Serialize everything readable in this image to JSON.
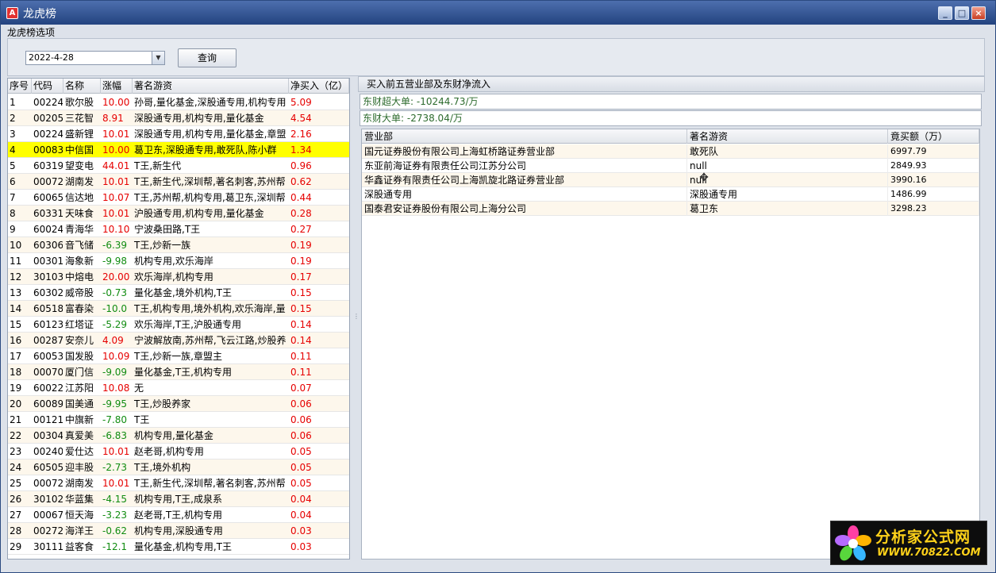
{
  "window": {
    "title": "龙虎榜",
    "app_icon": "A",
    "controls": [
      "_",
      "□",
      "×"
    ]
  },
  "filter": {
    "section_title": "龙虎榜选项",
    "date_value": "2022-4-28",
    "query_label": "查询"
  },
  "stock_list": {
    "headers": [
      "序号",
      "代码",
      "名称",
      "涨幅",
      "著名游资",
      "净买入（亿）"
    ],
    "rows": [
      {
        "no": "1",
        "code": "00224",
        "name": "歌尔股",
        "chg": "10.00",
        "fund": "孙哥,量化基金,深股通专用,机构专用",
        "net": "5.09",
        "dir": "up"
      },
      {
        "no": "2",
        "code": "00205",
        "name": "三花智",
        "chg": "8.91",
        "fund": "深股通专用,机构专用,量化基金",
        "net": "4.54",
        "dir": "up"
      },
      {
        "no": "3",
        "code": "00224",
        "name": "盛新锂",
        "chg": "10.01",
        "fund": "深股通专用,机构专用,量化基金,章盟",
        "net": "2.16",
        "dir": "up"
      },
      {
        "no": "4",
        "code": "00083",
        "name": "中信国",
        "chg": "10.00",
        "fund": "葛卫东,深股通专用,敢死队,陈小群",
        "net": "1.34",
        "dir": "up"
      },
      {
        "no": "5",
        "code": "60319",
        "name": "望变电",
        "chg": "44.01",
        "fund": "T王,新生代",
        "net": "0.96",
        "dir": "up"
      },
      {
        "no": "6",
        "code": "00072",
        "name": "湖南发",
        "chg": "10.01",
        "fund": "T王,新生代,深圳帮,著名刺客,苏州帮",
        "net": "0.62",
        "dir": "up"
      },
      {
        "no": "7",
        "code": "60065",
        "name": "信达地",
        "chg": "10.07",
        "fund": "T王,苏州帮,机构专用,葛卫东,深圳帮",
        "net": "0.44",
        "dir": "up"
      },
      {
        "no": "8",
        "code": "60331",
        "name": "天味食",
        "chg": "10.01",
        "fund": "沪股通专用,机构专用,量化基金",
        "net": "0.28",
        "dir": "up"
      },
      {
        "no": "9",
        "code": "60024",
        "name": "青海华",
        "chg": "10.10",
        "fund": "宁波桑田路,T王",
        "net": "0.27",
        "dir": "up"
      },
      {
        "no": "10",
        "code": "60306",
        "name": "音飞储",
        "chg": "-6.39",
        "fund": "T王,炒新一族",
        "net": "0.19",
        "dir": "down"
      },
      {
        "no": "11",
        "code": "00301",
        "name": "海象新",
        "chg": "-9.98",
        "fund": "机构专用,欢乐海岸",
        "net": "0.19",
        "dir": "down"
      },
      {
        "no": "12",
        "code": "30103",
        "name": "中熔电",
        "chg": "20.00",
        "fund": "欢乐海岸,机构专用",
        "net": "0.17",
        "dir": "up"
      },
      {
        "no": "13",
        "code": "60302",
        "name": "威帝股",
        "chg": "-0.73",
        "fund": "量化基金,境外机构,T王",
        "net": "0.15",
        "dir": "down"
      },
      {
        "no": "14",
        "code": "60518",
        "name": "富春染",
        "chg": "-10.0",
        "fund": "T王,机构专用,境外机构,欢乐海岸,量",
        "net": "0.15",
        "dir": "down"
      },
      {
        "no": "15",
        "code": "60123",
        "name": "红塔证",
        "chg": "-5.29",
        "fund": "欢乐海岸,T王,沪股通专用",
        "net": "0.14",
        "dir": "down"
      },
      {
        "no": "16",
        "code": "00287",
        "name": "安奈儿",
        "chg": "4.09",
        "fund": "宁波解放南,苏州帮,飞云江路,炒股养",
        "net": "0.14",
        "dir": "up"
      },
      {
        "no": "17",
        "code": "60053",
        "name": "国发股",
        "chg": "10.09",
        "fund": "T王,炒新一族,章盟主",
        "net": "0.11",
        "dir": "up"
      },
      {
        "no": "18",
        "code": "00070",
        "name": "厦门信",
        "chg": "-9.09",
        "fund": "量化基金,T王,机构专用",
        "net": "0.11",
        "dir": "down"
      },
      {
        "no": "19",
        "code": "60022",
        "name": "江苏阳",
        "chg": "10.08",
        "fund": "无",
        "net": "0.07",
        "dir": "up"
      },
      {
        "no": "20",
        "code": "60089",
        "name": "国美通",
        "chg": "-9.95",
        "fund": "T王,炒股养家",
        "net": "0.06",
        "dir": "down"
      },
      {
        "no": "21",
        "code": "00121",
        "name": "中旗新",
        "chg": "-7.80",
        "fund": "T王",
        "net": "0.06",
        "dir": "down"
      },
      {
        "no": "22",
        "code": "00304",
        "name": "真爱美",
        "chg": "-6.83",
        "fund": "机构专用,量化基金",
        "net": "0.06",
        "dir": "down"
      },
      {
        "no": "23",
        "code": "00240",
        "name": "爱仕达",
        "chg": "10.01",
        "fund": "赵老哥,机构专用",
        "net": "0.05",
        "dir": "up"
      },
      {
        "no": "24",
        "code": "60505",
        "name": "迎丰股",
        "chg": "-2.73",
        "fund": "T王,境外机构",
        "net": "0.05",
        "dir": "down"
      },
      {
        "no": "25",
        "code": "00072",
        "name": "湖南发",
        "chg": "10.01",
        "fund": "T王,新生代,深圳帮,著名刺客,苏州帮",
        "net": "0.05",
        "dir": "up"
      },
      {
        "no": "26",
        "code": "30102",
        "name": "华蓝集",
        "chg": "-4.15",
        "fund": "机构专用,T王,成泉系",
        "net": "0.04",
        "dir": "down"
      },
      {
        "no": "27",
        "code": "00067",
        "name": "恒天海",
        "chg": "-3.23",
        "fund": "赵老哥,T王,机构专用",
        "net": "0.04",
        "dir": "down"
      },
      {
        "no": "28",
        "code": "00272",
        "name": "海洋王",
        "chg": "-0.62",
        "fund": "机构专用,深股通专用",
        "net": "0.03",
        "dir": "down"
      },
      {
        "no": "29",
        "code": "30111",
        "name": "益客食",
        "chg": "-12.1",
        "fund": "量化基金,机构专用,T王",
        "net": "0.03",
        "dir": "down"
      }
    ]
  },
  "detail": {
    "header": "买入前五营业部及东财净流入",
    "super_large": {
      "label": "东财超大单:",
      "value": "-10244.73/万"
    },
    "large": {
      "label": "东财大单:",
      "value": "-2738.04/万"
    },
    "headers": [
      "营业部",
      "著名游资",
      "竟买额（万）"
    ],
    "rows": [
      {
        "dept": "国元证券股份有限公司上海虹桥路证券营业部",
        "fund": "敢死队",
        "amount": "6997.79"
      },
      {
        "dept": "东亚前海证券有限责任公司江苏分公司",
        "fund": "null",
        "amount": "2849.93"
      },
      {
        "dept": "华鑫证券有限责任公司上海凯旋北路证券营业部",
        "fund": "null",
        "amount": "3990.16"
      },
      {
        "dept": "深股通专用",
        "fund": "深股通专用",
        "amount": "1486.99"
      },
      {
        "dept": "国泰君安证券股份有限公司上海分公司",
        "fund": "葛卫东",
        "amount": "3298.23"
      }
    ]
  },
  "logo": {
    "title": "分析家公式网",
    "url": "WWW.70822.COM"
  },
  "icons": {
    "dropdown": "chevron-down-icon",
    "cursor": "move-cursor-icon",
    "grip": "splitter-grip-icon"
  },
  "colors": {
    "up": "#e60000",
    "down": "#118c11",
    "selected_row": "#ffff00",
    "alt_row": "#fdf7ec",
    "title_bar": "#23437f"
  }
}
